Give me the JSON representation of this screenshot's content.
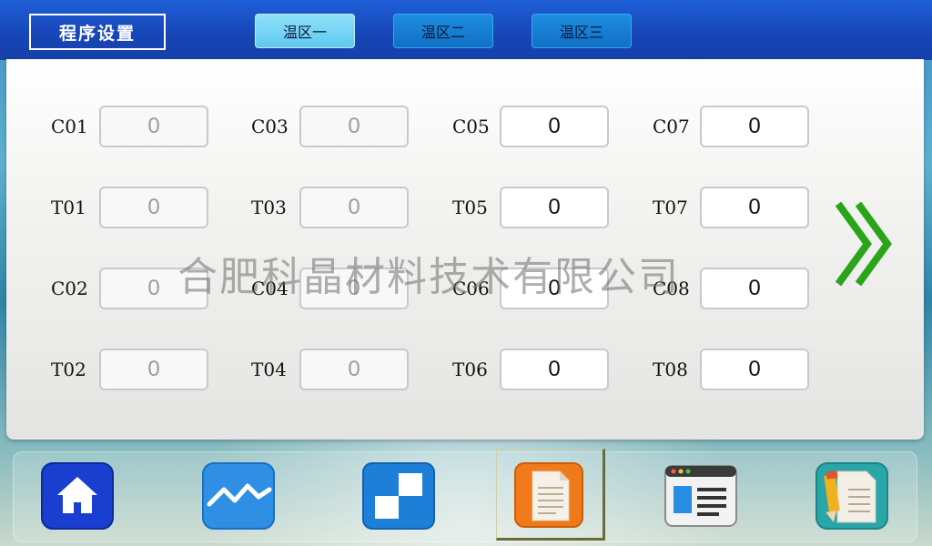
{
  "header": {
    "title": "程序设置",
    "tabs": [
      {
        "label": "温区一",
        "active": true
      },
      {
        "label": "温区二",
        "active": false
      },
      {
        "label": "温区三",
        "active": false
      }
    ]
  },
  "params": {
    "C01": {
      "label": "C01",
      "value": "0"
    },
    "C03": {
      "label": "C03",
      "value": "0"
    },
    "C05": {
      "label": "C05",
      "value": "0"
    },
    "C07": {
      "label": "C07",
      "value": "0"
    },
    "T01": {
      "label": "T01",
      "value": "0"
    },
    "T03": {
      "label": "T03",
      "value": "0"
    },
    "T05": {
      "label": "T05",
      "value": "0"
    },
    "T07": {
      "label": "T07",
      "value": "0"
    },
    "C02": {
      "label": "C02",
      "value": "0"
    },
    "C04": {
      "label": "C04",
      "value": "0"
    },
    "C06": {
      "label": "C06",
      "value": "0"
    },
    "C08": {
      "label": "C08",
      "value": "0"
    },
    "T02": {
      "label": "T02",
      "value": "0"
    },
    "T04": {
      "label": "T04",
      "value": "0"
    },
    "T06": {
      "label": "T06",
      "value": "0"
    },
    "T08": {
      "label": "T08",
      "value": "0"
    }
  },
  "watermark": "合肥科晶材料技术有限公司",
  "icons": {
    "next": "double-chevron-right-icon",
    "nav": [
      "home-icon",
      "trend-chart-icon",
      "pattern-icon",
      "program-document-icon",
      "screen-layout-icon",
      "edit-document-icon"
    ]
  },
  "colors": {
    "topbar": "#1747b8",
    "tab_active": "#5fc8ef",
    "tab_inactive": "#1070c6",
    "arrow": "#2aa51a"
  }
}
